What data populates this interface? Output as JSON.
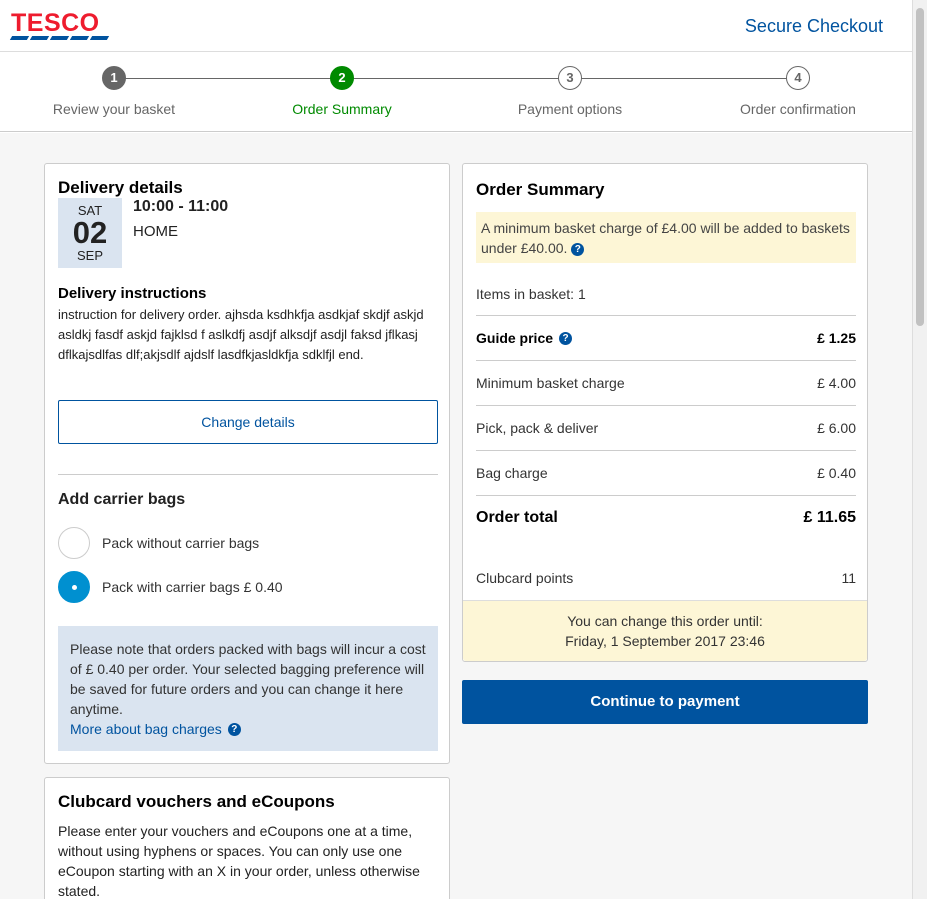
{
  "header": {
    "logo_text": "TESCO",
    "secure_checkout": "Secure Checkout"
  },
  "progress": {
    "steps": [
      {
        "number": "1",
        "label": "Review your basket",
        "state": "done"
      },
      {
        "number": "2",
        "label": "Order Summary",
        "state": "active"
      },
      {
        "number": "3",
        "label": "Payment options",
        "state": "pending"
      },
      {
        "number": "4",
        "label": "Order confirmation",
        "state": "pending"
      }
    ]
  },
  "delivery": {
    "title": "Delivery details",
    "date": {
      "dow": "SAT",
      "day": "02",
      "month": "SEP"
    },
    "time_slot": "10:00 - 11:00",
    "address": "HOME",
    "instructions_title": "Delivery instructions",
    "instructions_text": "instruction for delivery order. ajhsda ksdhkfja asdkjaf skdjf askjd asldkj fasdf askjd fajklsd f aslkdfj asdjf alksdjf asdjl faksd jflkasj dflkajsdlfas dlf;akjsdlf ajdslf lasdfkjasldkfja sdklfjl end.",
    "change_button": "Change details",
    "bags_title": "Add carrier bags",
    "bag_options": [
      {
        "label": "Pack without carrier bags",
        "checked": false
      },
      {
        "label": "Pack with carrier bags £ 0.40",
        "checked": true
      }
    ],
    "bag_note": "Please note that orders packed with bags will incur a cost of £ 0.40 per order. Your selected bagging preference will be saved for future orders and you can change it here anytime.",
    "bag_note_link": "More about bag charges"
  },
  "clubcard": {
    "title": "Clubcard vouchers and eCoupons",
    "text": "Please enter your vouchers and eCoupons one at a time, without using hyphens or spaces. You can only use one eCoupon starting with an X in your order, unless otherwise stated."
  },
  "summary": {
    "title": "Order Summary",
    "min_note": "A minimum basket charge of £4.00 will be added to baskets under £40.00.",
    "items_label": "Items in basket:",
    "items_value": "1",
    "rows": [
      {
        "label": "Guide price",
        "value": "£ 1.25"
      },
      {
        "label": "Minimum basket charge",
        "value": "£ 4.00"
      },
      {
        "label": "Pick, pack & deliver",
        "value": "£ 6.00"
      },
      {
        "label": "Bag charge",
        "value": "£ 0.40"
      },
      {
        "label": "Order total",
        "value": "£ 11.65"
      }
    ],
    "points_label": "Clubcard points",
    "points_value": "11",
    "change_until_line1": "You can change this order until:",
    "change_until_line2": "Friday, 1 September 2017 23:46"
  },
  "continue_button": "Continue to payment",
  "colors": {
    "brand_blue": "#00539f",
    "brand_red": "#ee1c2e",
    "active_green": "#008a00",
    "radio_blue": "#0090d0"
  }
}
